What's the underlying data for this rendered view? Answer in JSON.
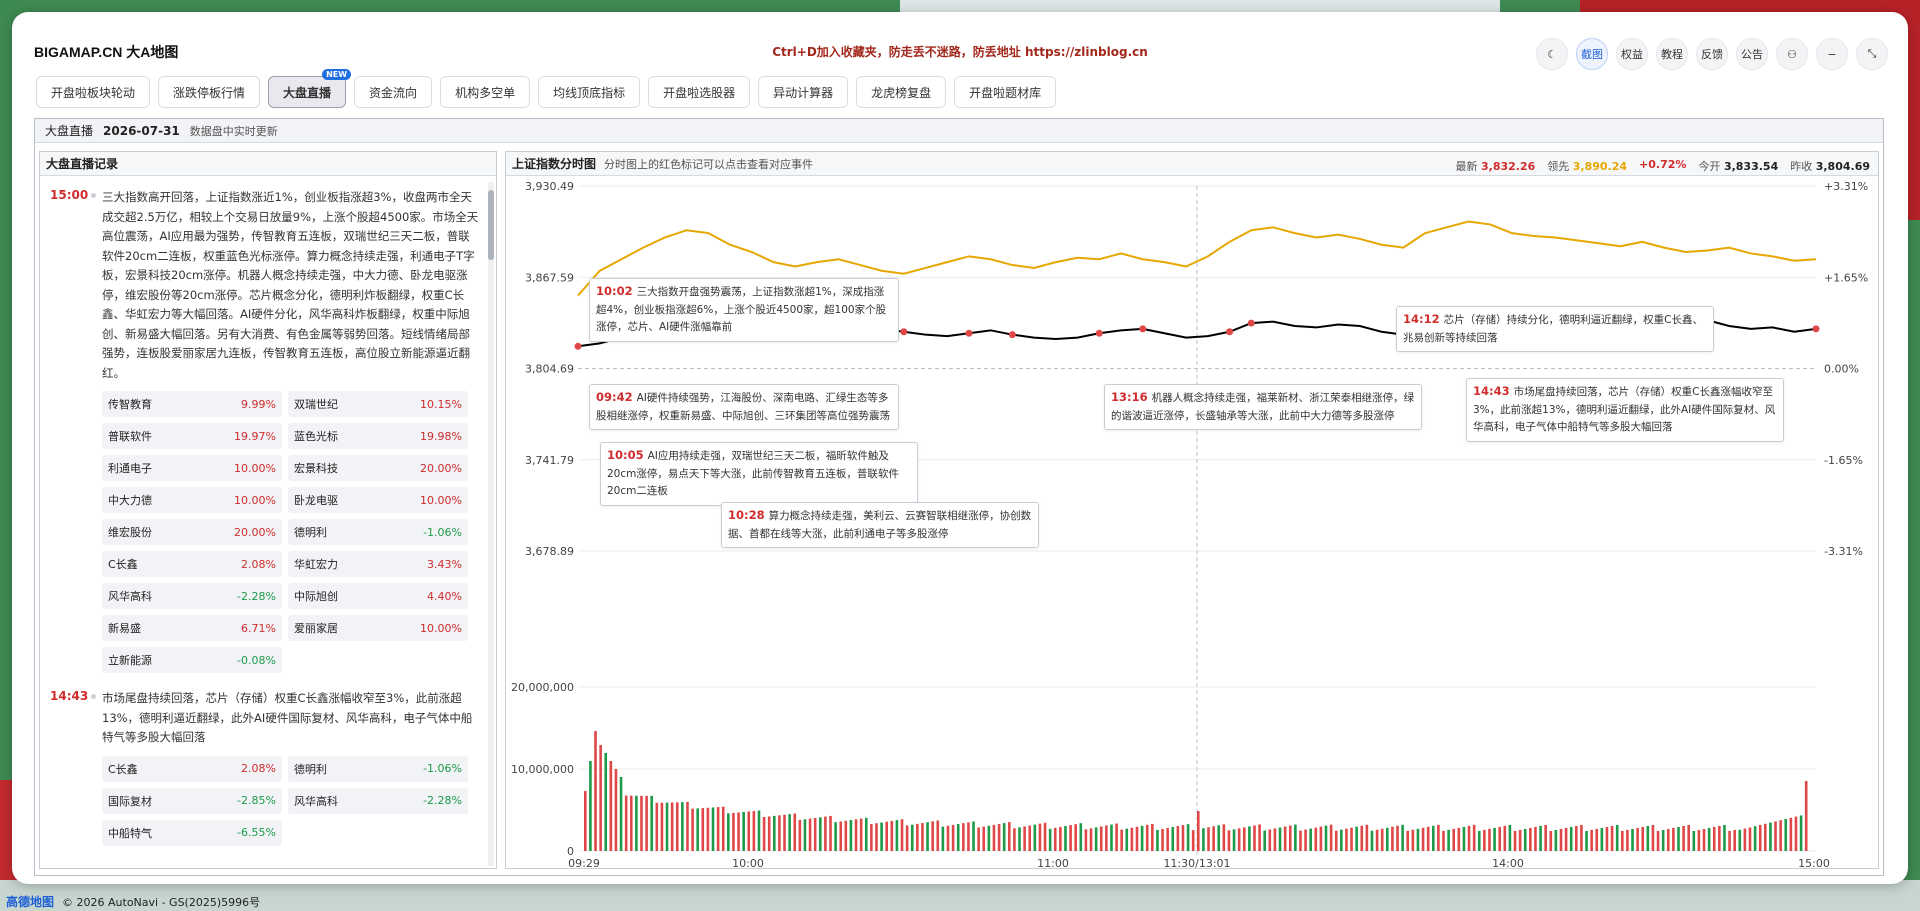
{
  "app": {
    "brand": "BIGAMAP.CN 大A地图",
    "notice": "Ctrl+D加入收藏夹，防走丢不迷路，防丢地址 https://zlinblog.cn",
    "icons": [
      {
        "name": "moon-icon",
        "label": "☾"
      },
      {
        "name": "screenshot-button",
        "label": "截图"
      },
      {
        "name": "equity-button",
        "label": "权益"
      },
      {
        "name": "tutorial-button",
        "label": "教程"
      },
      {
        "name": "feedback-button",
        "label": "反馈"
      },
      {
        "name": "announcement-button",
        "label": "公告"
      },
      {
        "name": "user-icon",
        "label": "⚇"
      },
      {
        "name": "minimize-icon",
        "label": "−"
      },
      {
        "name": "fullscreen-icon",
        "label": "⤡"
      }
    ]
  },
  "tabs": [
    {
      "label": "开盘啦板块轮动"
    },
    {
      "label": "涨跌停板行情"
    },
    {
      "label": "大盘直播",
      "badge": "NEW",
      "active": true
    },
    {
      "label": "资金流向"
    },
    {
      "label": "机构多空单"
    },
    {
      "label": "均线顶底指标"
    },
    {
      "label": "开盘啦选股器"
    },
    {
      "label": "异动计算器"
    },
    {
      "label": "龙虎榜复盘"
    },
    {
      "label": "开盘啦题材库"
    }
  ],
  "subheader": {
    "title": "大盘直播",
    "date": "2026-07-31",
    "update": "数据盘中实时更新"
  },
  "feed": {
    "title": "大盘直播记录",
    "entries": [
      {
        "time": "15:00",
        "text": "三大指数高开回落，上证指数涨近1%，创业板指涨超3%，收盘两市全天成交超2.5万亿，相较上个交易日放量9%，上涨个股超4500家。市场全天高位震荡，AI应用最为强势，传智教育五连板，双瑞世纪三天二板，普联软件20cm二连板，权重蓝色光标涨停。算力概念持续走强，利通电子T字板，宏景科技20cm涨停。机器人概念持续走强，中大力德、卧龙电驱涨停，维宏股份等20cm涨停。芯片概念分化，德明利炸板翻绿，权重C长鑫、华虹宏力等大幅回落。AI硬件分化，风华高科炸板翻绿，权重中际旭创、新易盛大幅回落。另有大消费、有色金属等弱势回落。短线情绪局部强势，连板股爱丽家居九连板，传智教育五连板，高位股立新能源逼近翻红。",
        "stocks": [
          {
            "name": "传智教育",
            "pct": "9.99%",
            "dir": "up"
          },
          {
            "name": "双瑞世纪",
            "pct": "10.15%",
            "dir": "up"
          },
          {
            "name": "普联软件",
            "pct": "19.97%",
            "dir": "up"
          },
          {
            "name": "蓝色光标",
            "pct": "19.98%",
            "dir": "up"
          },
          {
            "name": "利通电子",
            "pct": "10.00%",
            "dir": "up"
          },
          {
            "name": "宏景科技",
            "pct": "20.00%",
            "dir": "up"
          },
          {
            "name": "中大力德",
            "pct": "10.00%",
            "dir": "up"
          },
          {
            "name": "卧龙电驱",
            "pct": "10.00%",
            "dir": "up"
          },
          {
            "name": "维宏股份",
            "pct": "20.00%",
            "dir": "up"
          },
          {
            "name": "德明利",
            "pct": "-1.06%",
            "dir": "dn"
          },
          {
            "name": "C长鑫",
            "pct": "2.08%",
            "dir": "up"
          },
          {
            "name": "华虹宏力",
            "pct": "3.43%",
            "dir": "up"
          },
          {
            "name": "风华高科",
            "pct": "-2.28%",
            "dir": "dn"
          },
          {
            "name": "中际旭创",
            "pct": "4.40%",
            "dir": "up"
          },
          {
            "name": "新易盛",
            "pct": "6.71%",
            "dir": "up"
          },
          {
            "name": "爱丽家居",
            "pct": "10.00%",
            "dir": "up"
          },
          {
            "name": "立新能源",
            "pct": "-0.08%",
            "dir": "dn"
          }
        ]
      },
      {
        "time": "14:43",
        "text": "市场尾盘持续回落，芯片（存储）权重C长鑫涨幅收窄至3%，此前涨超13%，德明利逼近翻绿，此外AI硬件国际复材、风华高科，电子气体中船特气等多股大幅回落",
        "stocks": [
          {
            "name": "C长鑫",
            "pct": "2.08%",
            "dir": "up"
          },
          {
            "name": "德明利",
            "pct": "-1.06%",
            "dir": "dn"
          },
          {
            "name": "国际复材",
            "pct": "-2.85%",
            "dir": "dn"
          },
          {
            "name": "风华高科",
            "pct": "-2.28%",
            "dir": "dn"
          },
          {
            "name": "中船特气",
            "pct": "-6.55%",
            "dir": "dn"
          }
        ]
      }
    ]
  },
  "chart_header": {
    "title": "上证指数分时图",
    "hint": "分时图上的红色标记可以点击查看对应事件",
    "latest_label": "最新",
    "latest": "3,832.26",
    "lead_label": "领先",
    "lead": "3,890.24",
    "change": "+0.72%",
    "open_label": "今开",
    "open": "3,833.54",
    "prev_label": "昨收",
    "prev": "3,804.69"
  },
  "chart_data": {
    "type": "line",
    "title": "上证指数分时图",
    "y_left_ticks": [
      "3,930.49",
      "3,867.59",
      "3,804.69",
      "3,741.79",
      "3,678.89"
    ],
    "y_right_ticks": [
      "+3.31%",
      "+1.65%",
      "0.00%",
      "-1.65%",
      "-3.31%"
    ],
    "ylim": [
      3678.89,
      3930.49
    ],
    "x_ticks": [
      "09:29",
      "10:00",
      "11:00",
      "11:30/13:01",
      "14:00",
      "15:00"
    ],
    "volume_ticks": [
      "20,000,000",
      "10,000,000",
      "0"
    ],
    "series": [
      {
        "name": "最新",
        "color": "#000000",
        "values": [
          3820,
          3822,
          3826,
          3830,
          3836,
          3840,
          3842,
          3838,
          3835,
          3833,
          3832,
          3830,
          3829,
          3831,
          3832,
          3830,
          3828,
          3827,
          3829,
          3831,
          3828,
          3826,
          3825,
          3826,
          3829,
          3831,
          3832,
          3829,
          3826,
          3827,
          3830,
          3836,
          3837,
          3834,
          3833,
          3835,
          3834,
          3830,
          3828,
          3833,
          3838,
          3836,
          3832,
          3833,
          3837,
          3839,
          3840,
          3837,
          3834,
          3833,
          3838,
          3842,
          3838,
          3834,
          3832,
          3833,
          3830,
          3832
        ]
      },
      {
        "name": "领先",
        "color": "#e6a700",
        "values": [
          3855,
          3872,
          3880,
          3888,
          3895,
          3900,
          3898,
          3890,
          3885,
          3878,
          3875,
          3878,
          3880,
          3876,
          3872,
          3870,
          3874,
          3878,
          3882,
          3880,
          3876,
          3874,
          3878,
          3881,
          3880,
          3884,
          3880,
          3878,
          3875,
          3882,
          3892,
          3900,
          3902,
          3898,
          3895,
          3897,
          3894,
          3890,
          3888,
          3898,
          3902,
          3906,
          3904,
          3898,
          3896,
          3895,
          3893,
          3891,
          3889,
          3892,
          3888,
          3885,
          3886,
          3888,
          3884,
          3882,
          3879,
          3880
        ]
      }
    ],
    "events": [
      {
        "time": "10:02",
        "text": "三大指数开盘强势震荡，上证指数涨超1%，深成指涨超4%，创业板指涨超6%，上涨个股近4500家，超100家个股涨停，芯片、AI硬件涨幅靠前"
      },
      {
        "time": "09:42",
        "text": "AI硬件持续强势，江海股份、深南电路、汇绿生态等多股相继涨停，权重新易盛、中际旭创、三环集团等高位强势震荡"
      },
      {
        "time": "10:05",
        "text": "AI应用持续走强，双瑞世纪三天二板，福昕软件触及20cm涨停，易点天下等大涨，此前传智教育五连板，普联软件20cm二连板"
      },
      {
        "time": "10:28",
        "text": "算力概念持续走强，美利云、云赛智联相继涨停，协创数据、首都在线等大涨，此前利通电子等多股涨停"
      },
      {
        "time": "13:16",
        "text": "机器人概念持续走强，福莱新材、浙江荣泰相继涨停，绿的谐波逼近涨停，长盛轴承等大涨，此前中大力德等多股涨停"
      },
      {
        "time": "14:12",
        "text": "芯片（存储）持续分化，德明利逼近翻绿，权重C长鑫、兆易创新等持续回落"
      },
      {
        "time": "14:43",
        "text": "市场尾盘持续回落，芯片（存储）权重C长鑫涨幅收窄至3%，此前涨超13%，德明利逼近翻绿，此外AI硬件国际复材、风华高科，电子气体中船特气等多股大幅回落"
      }
    ]
  },
  "map_footer": {
    "logo": "高德地图",
    "copyright": "© 2026 AutoNavi - GS(2025)5996号"
  }
}
